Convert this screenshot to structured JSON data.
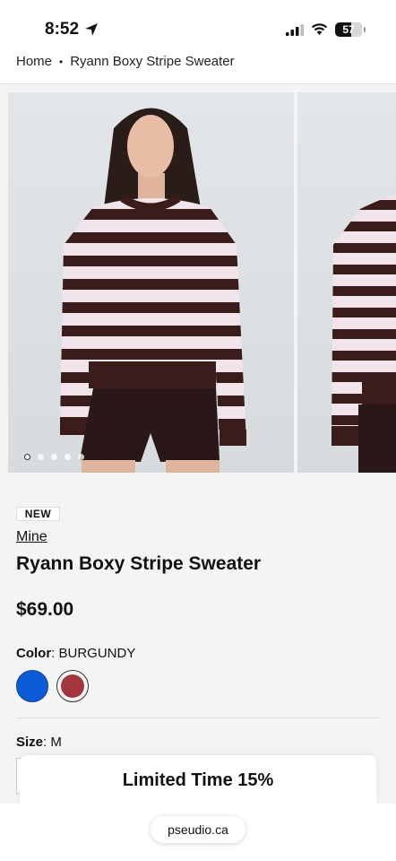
{
  "status_bar": {
    "time": "8:52",
    "battery": "57",
    "icons": [
      "location-arrow-icon",
      "signal-icon",
      "wifi-icon",
      "battery-icon"
    ]
  },
  "breadcrumb": {
    "home": "Home",
    "separator": "•",
    "current": "Ryann Boxy Stripe Sweater"
  },
  "gallery": {
    "slide_count": 5,
    "active_slide": 1
  },
  "product": {
    "badge": "NEW",
    "brand": "Mine",
    "title": "Ryann Boxy Stripe Sweater",
    "price": "$69.00",
    "color_label": "Color",
    "color_value": ": BURGUNDY",
    "swatches": [
      {
        "name": "blue",
        "hex": "#0b5bd7"
      },
      {
        "name": "burgundy",
        "hex": "#a3363c"
      }
    ],
    "size_label": "Size",
    "size_value": ": M"
  },
  "promo": {
    "text": "Limited Time 15%"
  },
  "browser": {
    "url": "pseudio.ca"
  },
  "colors": {
    "stripe_dark": "#3a1c1a",
    "stripe_light": "#f1e4ea"
  }
}
